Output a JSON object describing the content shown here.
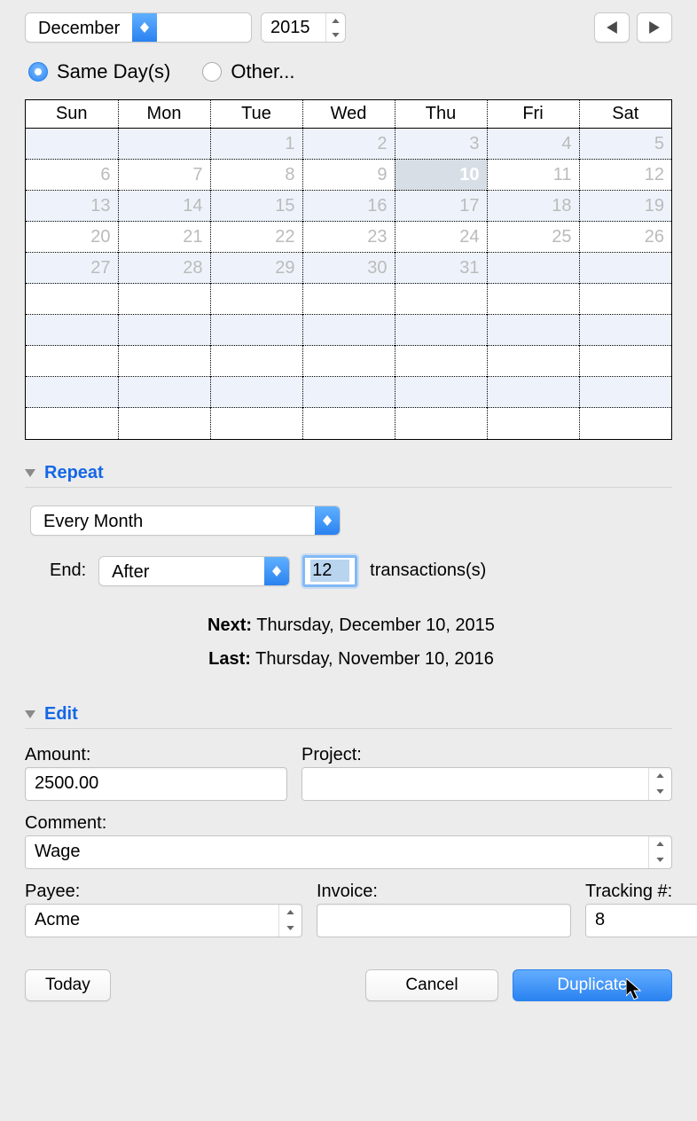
{
  "header": {
    "month": "December",
    "year": "2015"
  },
  "mode": {
    "same_day_label": "Same Day(s)",
    "other_label": "Other..."
  },
  "calendar": {
    "weekdays": [
      "Sun",
      "Mon",
      "Tue",
      "Wed",
      "Thu",
      "Fri",
      "Sat"
    ],
    "weeks": [
      [
        "",
        "",
        "1",
        "2",
        "3",
        "4",
        "5"
      ],
      [
        "6",
        "7",
        "8",
        "9",
        "10",
        "11",
        "12"
      ],
      [
        "13",
        "14",
        "15",
        "16",
        "17",
        "18",
        "19"
      ],
      [
        "20",
        "21",
        "22",
        "23",
        "24",
        "25",
        "26"
      ],
      [
        "27",
        "28",
        "29",
        "30",
        "31",
        "",
        ""
      ],
      [
        "",
        "",
        "",
        "",
        "",
        "",
        ""
      ],
      [
        "",
        "",
        "",
        "",
        "",
        "",
        ""
      ],
      [
        "",
        "",
        "",
        "",
        "",
        "",
        ""
      ],
      [
        "",
        "",
        "",
        "",
        "",
        "",
        ""
      ],
      [
        "",
        "",
        "",
        "",
        "",
        "",
        ""
      ]
    ],
    "selected": {
      "week": 1,
      "col": 4
    }
  },
  "sections": {
    "repeat_label": "Repeat",
    "edit_label": "Edit"
  },
  "repeat": {
    "frequency": "Every Month",
    "end_label": "End:",
    "end_mode": "After",
    "end_count": "12",
    "transactions_label": "transactions(s)",
    "next_label": "Next:",
    "next_value": "Thursday, December 10, 2015",
    "last_label": "Last:",
    "last_value": "Thursday, November 10, 2016"
  },
  "edit": {
    "amount_label": "Amount:",
    "amount_value": "2500.00",
    "project_label": "Project:",
    "project_value": "",
    "comment_label": "Comment:",
    "comment_value": "Wage",
    "payee_label": "Payee:",
    "payee_value": "Acme",
    "invoice_label": "Invoice:",
    "invoice_value": "",
    "tracking_label": "Tracking #:",
    "tracking_value": "8"
  },
  "buttons": {
    "today": "Today",
    "cancel": "Cancel",
    "duplicate": "Duplicate"
  }
}
